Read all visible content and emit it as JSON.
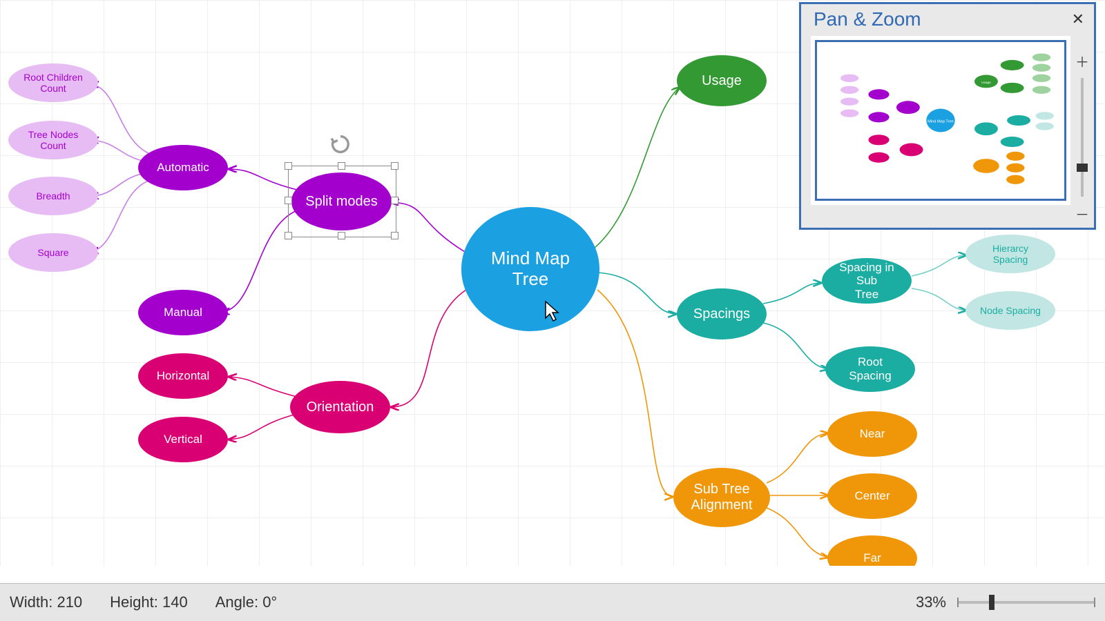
{
  "panel": {
    "title": "Pan & Zoom"
  },
  "status": {
    "width_label": "Width: 210",
    "height_label": "Height: 140",
    "angle_label": "Angle: 0°",
    "zoom_label": "33%"
  },
  "nodes": {
    "root": "Mind Map Tree",
    "usage": "Usage",
    "spacings": "Spacings",
    "spacing_sub": "Spacing in Sub\nTree",
    "root_spacing": "Root Spacing",
    "hierarchy": "Hierarcy Spacing",
    "node_spacing": "Node Spacing",
    "subtree": "Sub Tree\nAlignment",
    "near": "Near",
    "center": "Center",
    "far": "Far",
    "split": "Split modes",
    "automatic": "Automatic",
    "manual": "Manual",
    "rcc": "Root Children\nCount",
    "tnc": "Tree Nodes Count",
    "breadth": "Breadth",
    "square": "Square",
    "orientation": "Orientation",
    "horizontal": "Horizontal",
    "vertical": "Vertical"
  },
  "selection": {
    "node": "split"
  },
  "colors": {
    "blue": "#1ba1e2",
    "green": "#339933",
    "teal": "#1bada2",
    "orange": "#f09609",
    "purple": "#a300ce",
    "magenta": "#d90073"
  },
  "diagram": {
    "type": "mindmap",
    "root": "Mind Map Tree",
    "branches": [
      {
        "label": "Usage",
        "color": "green",
        "children": []
      },
      {
        "label": "Spacings",
        "color": "teal",
        "children": [
          {
            "label": "Spacing in Sub Tree",
            "children": [
              {
                "label": "Hierarcy Spacing"
              },
              {
                "label": "Node Spacing"
              }
            ]
          },
          {
            "label": "Root Spacing"
          }
        ]
      },
      {
        "label": "Sub Tree Alignment",
        "color": "orange",
        "children": [
          {
            "label": "Near"
          },
          {
            "label": "Center"
          },
          {
            "label": "Far"
          }
        ]
      },
      {
        "label": "Split modes",
        "color": "purple",
        "selected": true,
        "children": [
          {
            "label": "Automatic",
            "children": [
              {
                "label": "Root Children Count"
              },
              {
                "label": "Tree Nodes Count"
              },
              {
                "label": "Breadth"
              },
              {
                "label": "Square"
              }
            ]
          },
          {
            "label": "Manual"
          }
        ]
      },
      {
        "label": "Orientation",
        "color": "magenta",
        "children": [
          {
            "label": "Horizontal"
          },
          {
            "label": "Vertical"
          }
        ]
      }
    ]
  }
}
